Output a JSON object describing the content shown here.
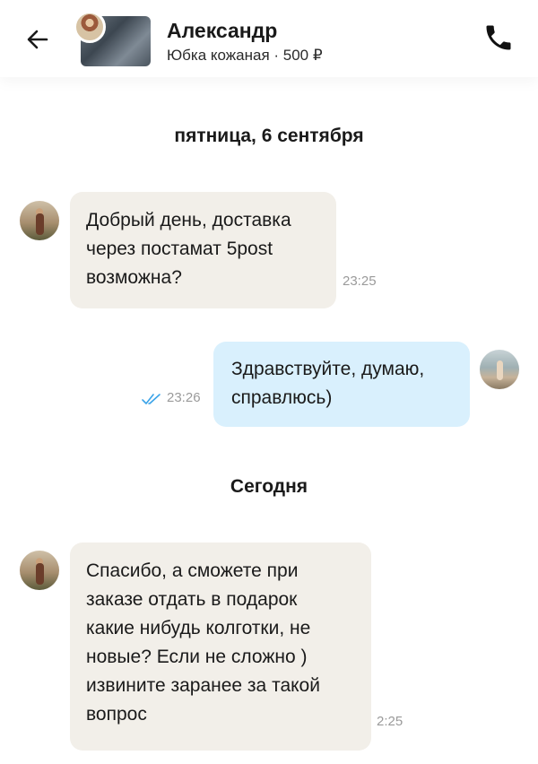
{
  "header": {
    "contact_name": "Александр",
    "product_line": "Юбка кожаная · 500 ₽"
  },
  "date_separators": {
    "first": "пятница, 6 сентября",
    "second": "Сегодня"
  },
  "messages": [
    {
      "direction": "incoming",
      "text": "Добрый день, доставка\nчерез постамат 5post\nвозможна?",
      "time": "23:25"
    },
    {
      "direction": "outgoing",
      "text": "Здравствуйте, думаю,\nсправлюсь)",
      "time": "23:26",
      "status": "read"
    },
    {
      "direction": "incoming",
      "text": "Спасибо, а сможете при\nзаказе отдать в подарок\nкакие нибудь колготки, не\nновые? Если не сложно )\nизвините заранее за такой\nвопрос",
      "time": "2:25"
    }
  ],
  "colors": {
    "incoming_bubble": "#f2efe9",
    "outgoing_bubble": "#d9f0fd",
    "read_ticks": "#3aa3e8",
    "timestamp": "#9a9a9a"
  },
  "icons": {
    "back": "arrow-left-icon",
    "call": "phone-icon",
    "read_status": "double-check-icon"
  }
}
